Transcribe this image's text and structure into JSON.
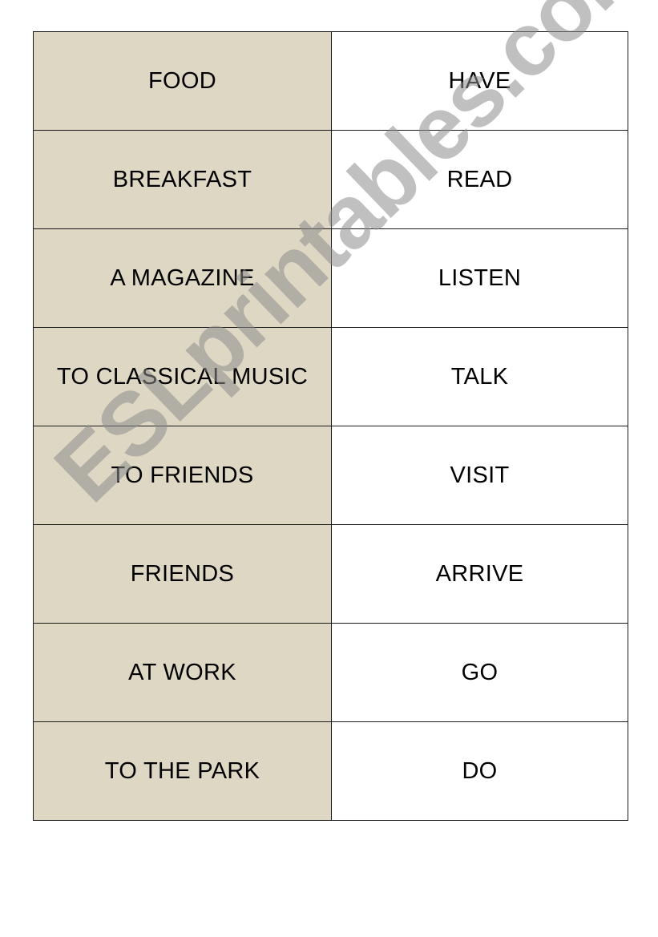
{
  "worksheet": {
    "rows": [
      {
        "left": "FOOD",
        "right": "HAVE"
      },
      {
        "left": "BREAKFAST",
        "right": "READ"
      },
      {
        "left": "A MAGAZINE",
        "right": "LISTEN"
      },
      {
        "left": "TO CLASSICAL MUSIC",
        "right": "TALK"
      },
      {
        "left": "TO FRIENDS",
        "right": "VISIT"
      },
      {
        "left": "FRIENDS",
        "right": "ARRIVE"
      },
      {
        "left": "AT WORK",
        "right": "GO"
      },
      {
        "left": "TO THE PARK",
        "right": "DO"
      }
    ],
    "colors": {
      "left_column_bg": "#ddd7c4",
      "right_column_bg": "#ffffff",
      "border": "#1a1a1a",
      "watermark": "#8c8c8c"
    }
  },
  "watermark": {
    "text": "ESLprintables.com"
  }
}
